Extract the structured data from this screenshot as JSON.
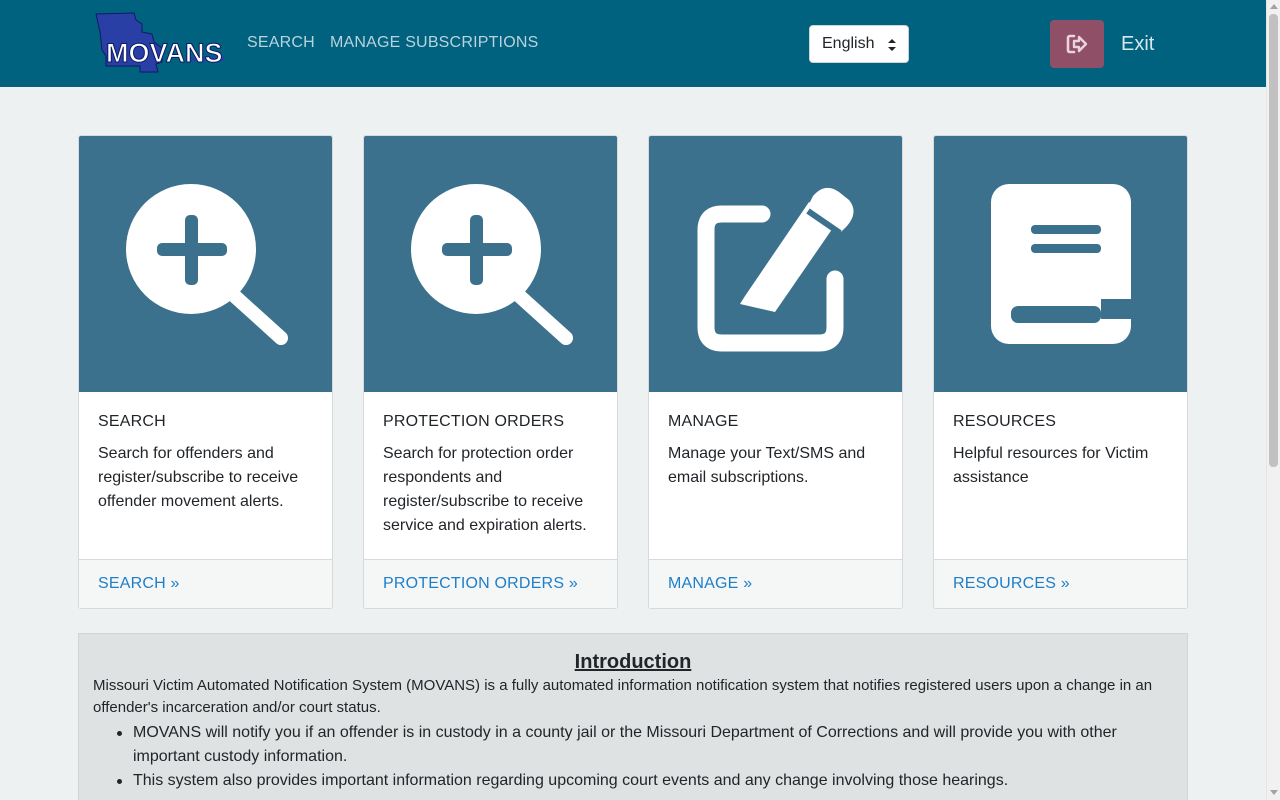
{
  "header": {
    "logo_text": "MOVANS",
    "nav": [
      {
        "label": "SEARCH"
      },
      {
        "label": "MANAGE SUBSCRIPTIONS"
      }
    ],
    "language": {
      "selected": "English"
    },
    "exit_label": "Exit",
    "colors": {
      "bar": "#00627f",
      "exit_button": "#8e4f67"
    }
  },
  "cards": [
    {
      "icon": "search-plus-icon",
      "title": "SEARCH",
      "text": "Search for offenders and register/subscribe to receive offender movement alerts.",
      "link": "SEARCH »"
    },
    {
      "icon": "search-plus-icon",
      "title": "PROTECTION ORDERS",
      "text": "Search for protection order respondents and register/subscribe to receive service and expiration alerts.",
      "link": "PROTECTION ORDERS »"
    },
    {
      "icon": "edit-icon",
      "title": "MANAGE",
      "text": "Manage your Text/SMS and email subscriptions.",
      "link": "MANAGE »"
    },
    {
      "icon": "book-icon",
      "title": "RESOURCES",
      "text": "Helpful resources for Victim assistance",
      "link": "RESOURCES »"
    }
  ],
  "intro": {
    "heading": "Introduction",
    "paragraph": "Missouri Victim Automated Notification System (MOVANS) is a fully automated information notification system that notifies registered users upon a change in an offender's incarceration and/or court status.",
    "bullets": [
      "MOVANS will notify you if an offender is in custody in a county jail or the Missouri Department of Corrections and will provide you with other important custody information.",
      "This system also provides important information regarding upcoming court events and any change involving those hearings."
    ]
  }
}
